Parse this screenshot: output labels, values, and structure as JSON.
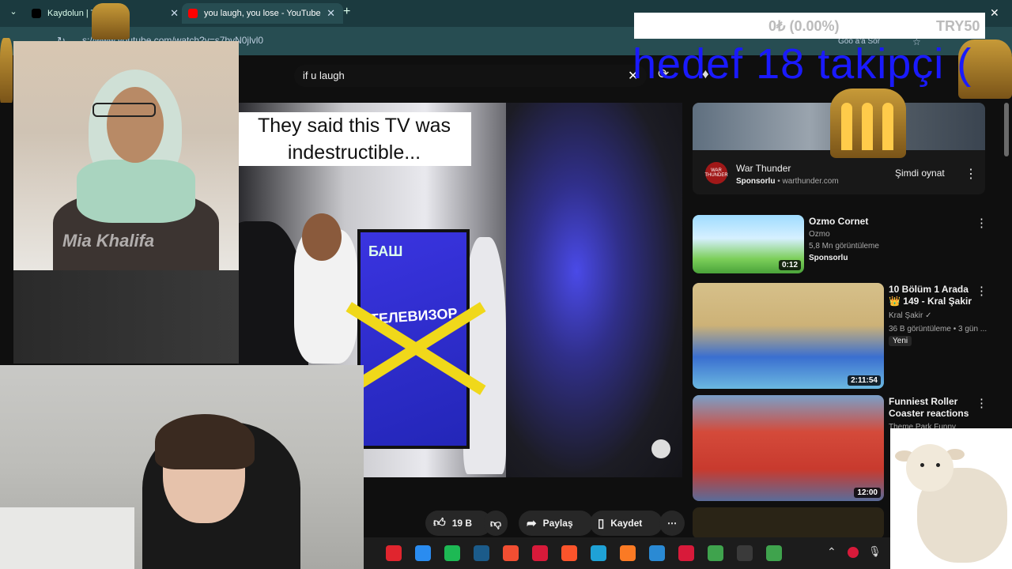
{
  "browser": {
    "tabs": [
      {
        "label": "Kaydolun | TikTo",
        "icon": "tiktok-icon"
      },
      {
        "label": "you laugh, you lose - YouTube",
        "icon": "youtube-icon"
      }
    ],
    "url": "s://www.youtube.com/watch?v=s7bvN0jlvl0",
    "reload_glyph": "↻",
    "close_glyph": "✕",
    "newtab_glyph": "+",
    "menu_glyph": "⌄"
  },
  "youtube": {
    "search_value": "if u laugh",
    "header_google": "Goo  a'a Sor",
    "clear_glyph": "✕"
  },
  "stream_overlay": {
    "donation_amount": "0₺ (0.00%)",
    "donation_goal": "TRY50",
    "goal_text": "hedef 18 takipçi (",
    "webcam_name": "Mia Khalifa"
  },
  "video": {
    "caption": "They said this TV was indestructible...",
    "tv_brand": "БАШ",
    "tv_label": "ТЕЛЕВИЗОР"
  },
  "actions": {
    "like_count": "19 B",
    "share_label": "Paylaş",
    "save_label": "Kaydet",
    "more_glyph": "⋯"
  },
  "sidebar": {
    "ad": {
      "title": "War Thunder",
      "sponsor_label": "Sponsorlu",
      "domain": "warthunder.com",
      "cta": "Şimdi oynat",
      "logo_text": "WAR THUNDER"
    },
    "videos": [
      {
        "title": "Ozmo Cornet",
        "channel": "Ozmo",
        "views": "5,8 Mn görüntüleme",
        "badge": "Sponsorlu",
        "duration": "0:12"
      },
      {
        "title": "10 Bölüm 1 Arada 👑 149 - Kral Şakir",
        "channel": "Kral Şakir ✓",
        "views": "36 B görüntüleme • 3 gün ...",
        "badge": "Yeni",
        "duration": "2:11:54"
      },
      {
        "title": "Funniest Roller Coaster reactions",
        "channel": "Theme Park Funny",
        "duration": "12:00"
      }
    ],
    "menu_glyph": "⋮"
  },
  "taskbar": {
    "apps": [
      {
        "name": "opera-icon",
        "color": "#e0252e"
      },
      {
        "name": "copilot-icon",
        "color": "#2a8cf0"
      },
      {
        "name": "spotify-icon",
        "color": "#1db954"
      },
      {
        "name": "steam-icon",
        "color": "#1b5b8a"
      },
      {
        "name": "git-icon",
        "color": "#f14e32"
      },
      {
        "name": "app-red-icon",
        "color": "#d81a3a"
      },
      {
        "name": "brave-icon",
        "color": "#fb542b"
      },
      {
        "name": "edge-icon",
        "color": "#1fa2d6"
      },
      {
        "name": "xampp-icon",
        "color": "#fb7a24"
      },
      {
        "name": "vscode-icon",
        "color": "#2a8ad4"
      },
      {
        "name": "vivaldi-icon",
        "color": "#d81a3a"
      },
      {
        "name": "chrome-icon",
        "color": "#3fa34d"
      },
      {
        "name": "obs-icon",
        "color": "#3a3a3a"
      },
      {
        "name": "chrome-alt-icon",
        "color": "#3fa34d"
      }
    ],
    "tray": {
      "chevron": "⌃",
      "mic": "🎙"
    }
  },
  "colors": {
    "goal_text": "#1a1aff",
    "donation_text": "#bbbbbb",
    "tab_bar": "#1b3a3f"
  }
}
